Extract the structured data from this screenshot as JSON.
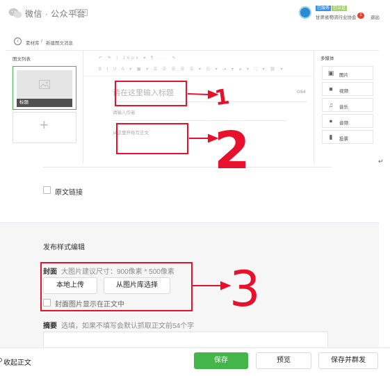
{
  "header": {
    "brand": "微信 · 公众平台",
    "beta": "beta",
    "account_tag_primary": "已服务",
    "account_tag_secondary": "已认证",
    "account_name": "甘肃省物流行业协会",
    "notification_count": "1",
    "logout": "退出"
  },
  "breadcrumb": {
    "parent": "素材库",
    "separator": "/",
    "current": "新建图文消息"
  },
  "left_panel": {
    "title": "图文列表",
    "card_label": "标题",
    "add_symbol": "+"
  },
  "toolbar": {
    "row1": "↶  ↷  |  16px ▾  ¶  ···  ✎",
    "row2": "B I U A ▾ ▦ ▾ ☰ ☰ ☰ ☰ ☰ ▾ ☷ ▾ ⇥ ▾ ⌀ ▾ ⛶ ▾ ⛓ ▾"
  },
  "editor": {
    "title_placeholder": "请在这里输入标题",
    "title_count": "0/64",
    "author_placeholder": "请输入作者",
    "body_placeholder": "从这里开始写正文"
  },
  "right_panel": {
    "title": "多媒体",
    "items": [
      {
        "label": "图片",
        "icon": "image-icon"
      },
      {
        "label": "视频",
        "icon": "video-icon"
      },
      {
        "label": "音乐",
        "icon": "music-icon"
      },
      {
        "label": "音频",
        "icon": "microphone-icon"
      },
      {
        "label": "投票",
        "icon": "vote-icon"
      }
    ]
  },
  "original_link": {
    "label": "原文链接"
  },
  "publish_style": {
    "heading": "发布样式编辑",
    "cover_label": "封面",
    "cover_hint": "大图片建议尺寸：900像素 * 500像素",
    "upload_local": "本地上传",
    "choose_from_library": "从图片库选择",
    "show_cover_in_body": "封面图片显示在正文中",
    "summary_label": "摘要",
    "summary_hint": "选填，如果不填写会默认抓取正文前54个字"
  },
  "footer": {
    "collapse": "收起正文",
    "save": "保存",
    "preview": "预览",
    "save_and_send": "保存并群发"
  },
  "annotations": {
    "mark1": "1",
    "mark2": "2",
    "mark3": "3",
    "color": "#e8112d"
  },
  "colors": {
    "accent_green": "#44b549",
    "annotation_red": "#e8112d"
  }
}
